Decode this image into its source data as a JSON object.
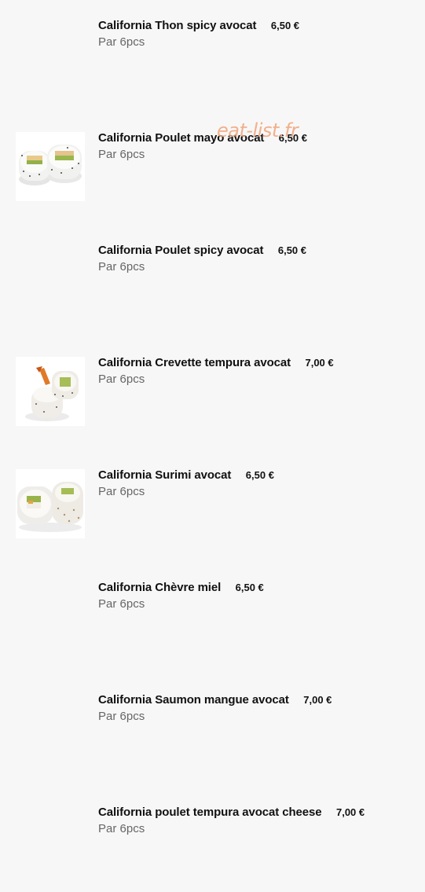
{
  "watermark": "eat-list.fr",
  "items": [
    {
      "name": "California Thon spicy avocat",
      "price": "6,50 €",
      "desc": "Par 6pcs",
      "image": ""
    },
    {
      "name": "California Poulet mayo avocat",
      "price": "6,50 €",
      "desc": "Par 6pcs",
      "image": "california-roll-chicken"
    },
    {
      "name": "California Poulet spicy avocat",
      "price": "6,50 €",
      "desc": "Par 6pcs",
      "image": ""
    },
    {
      "name": "California Crevette tempura avocat",
      "price": "7,00 €",
      "desc": "Par 6pcs",
      "image": "california-roll-shrimp-tempura"
    },
    {
      "name": "California Surimi avocat",
      "price": "6,50 €",
      "desc": "Par 6pcs",
      "image": "california-roll-surimi"
    },
    {
      "name": "California Chèvre miel",
      "price": "6,50 €",
      "desc": "Par 6pcs",
      "image": ""
    },
    {
      "name": "California Saumon mangue avocat",
      "price": "7,00 €",
      "desc": "Par 6pcs",
      "image": ""
    },
    {
      "name": "California poulet tempura avocat cheese",
      "price": "7,00 €",
      "desc": "Par 6pcs",
      "image": ""
    }
  ]
}
